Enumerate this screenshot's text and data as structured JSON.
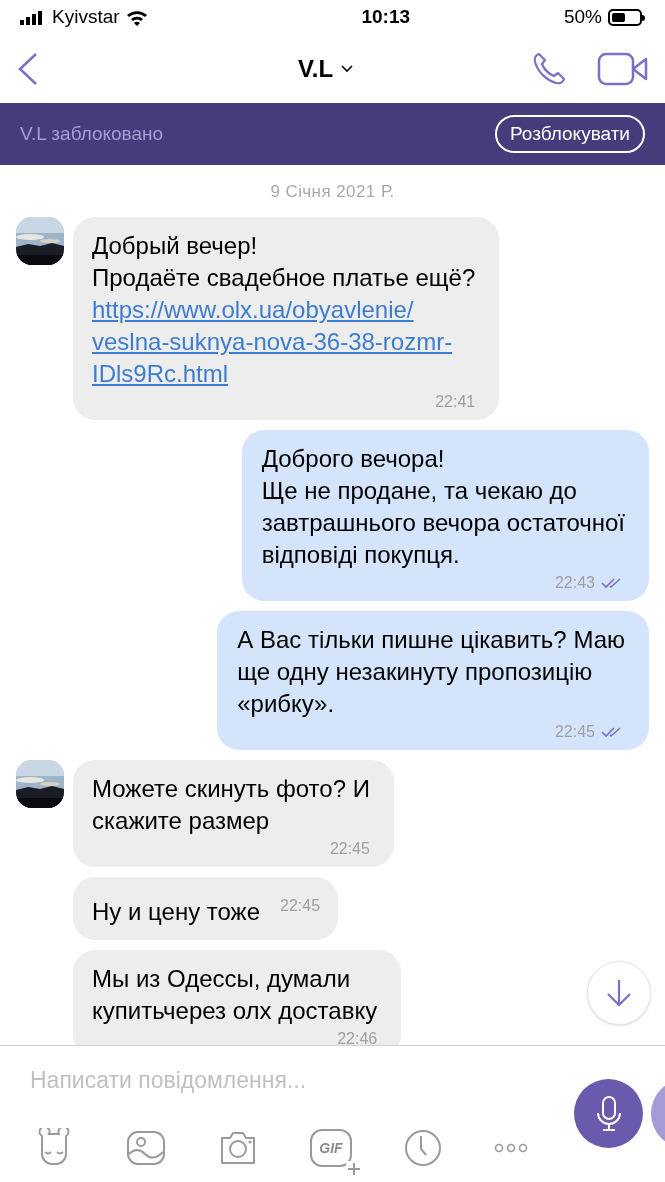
{
  "status_bar": {
    "carrier": "Kyivstar",
    "time": "10:13",
    "battery": "50%"
  },
  "header": {
    "title": "V.L"
  },
  "blocked_banner": {
    "text": "V.L заблоковано",
    "button": "Розблокувати"
  },
  "date": "9 Січня 2021 Р.",
  "messages": [
    {
      "kind": "incoming",
      "avatar": true,
      "text": "Добрый вечер!\nПродаёте свадебное платье ещё?",
      "link": "https://www.olx.ua/obyavlenie/\nveslna-suknya-nova-36-38-rozmr-\nIDls9Rc.html",
      "time": "22:41"
    },
    {
      "kind": "outgoing",
      "text": "Доброго вечора!\nЩе не продане, та чекаю до\nзавтрашнього вечора остаточної\nвідповіді покупця.",
      "time": "22:43",
      "read": true
    },
    {
      "kind": "outgoing",
      "text": "А Вас тільки пишне цікавить? Маю\nще одну незакинуту пропозицію\n«рибку».",
      "time": "22:45",
      "read": true
    },
    {
      "kind": "incoming",
      "avatar": true,
      "text": "Можете скинуть фото? И\nскажите размер",
      "time": "22:45"
    },
    {
      "kind": "incoming",
      "avatar": false,
      "inline_time": true,
      "text": "Ну и цену тоже",
      "time": "22:45"
    },
    {
      "kind": "incoming",
      "avatar": false,
      "text": "Мы из Одессы, думали\nкупитьчерез олх доставку",
      "time": "22:46"
    }
  ],
  "composer": {
    "placeholder": "Написати повідомлення...",
    "gif_label": "GIF"
  }
}
